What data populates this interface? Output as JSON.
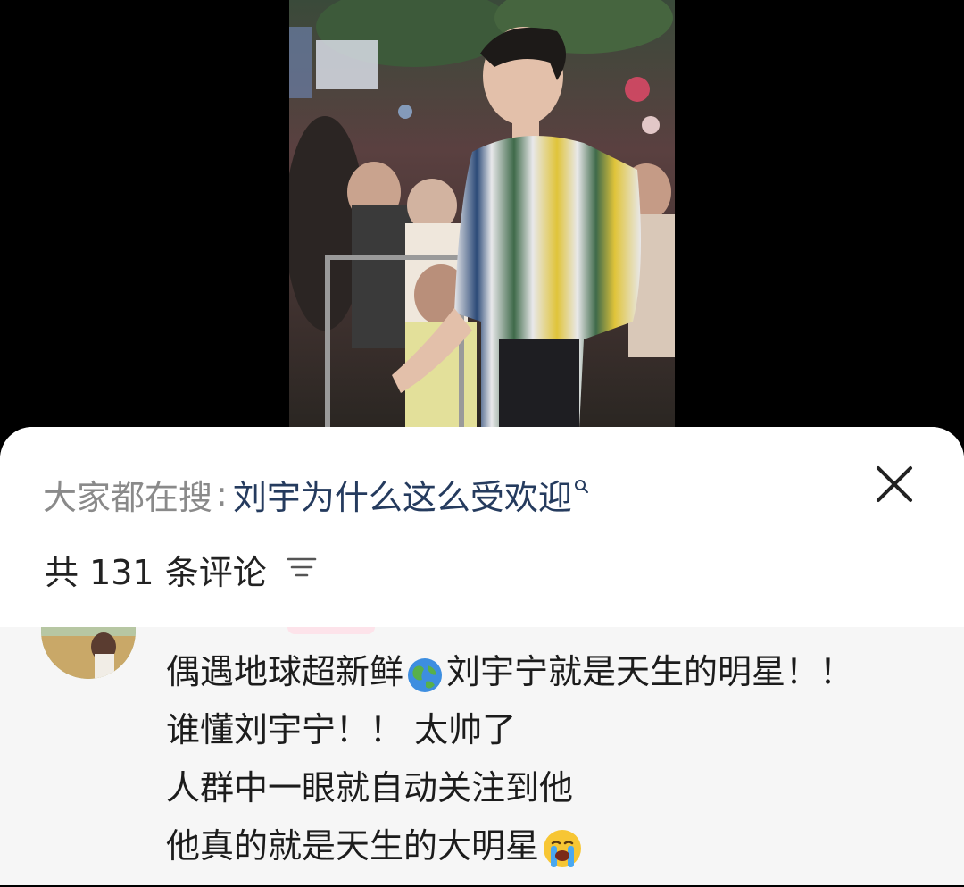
{
  "search": {
    "prefix": "大家都在搜",
    "colon": ":",
    "query": "刘宇为什么这么受欢迎"
  },
  "comments_header": {
    "count_label": "共 131 条评论"
  },
  "comment": {
    "line1_a": "偶遇地球超新鲜",
    "line1_emoji": "globe-emoji",
    "line1_b": "刘宇宁就是天生的明星！！",
    "line2": "谁懂刘宇宁！！ 太帅了",
    "line3": "人群中一眼就自动关注到他",
    "line4_a": "他真的就是天生的大明星",
    "line4_emoji": "crying-face-emoji"
  },
  "icons": {
    "close": "close-icon",
    "sort": "sort-lines-icon",
    "search_mini": "search-icon"
  },
  "colors": {
    "query_text": "#253b5e",
    "muted_text": "#8a8a8a",
    "sheet_bg": "#f6f6f6"
  }
}
